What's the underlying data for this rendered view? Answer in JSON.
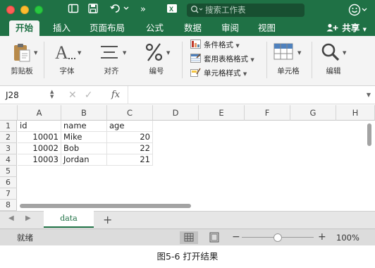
{
  "titlebar": {
    "search_placeholder": "搜索工作表",
    "colors": {
      "brand": "#1f7145"
    }
  },
  "tabs": [
    {
      "label": "开始",
      "active": true
    },
    {
      "label": "插入"
    },
    {
      "label": "页面布局"
    },
    {
      "label": "公式"
    },
    {
      "label": "数据"
    },
    {
      "label": "审阅"
    },
    {
      "label": "视图"
    }
  ],
  "share_label": "共享",
  "ribbon": {
    "clipboard": "剪贴板",
    "font": "字体",
    "align": "对齐",
    "number": "编号",
    "cf_conditional": "条件格式",
    "cf_table": "套用表格格式",
    "cf_cellstyle": "单元格样式",
    "cells": "单元格",
    "edit": "编辑"
  },
  "formula_bar": {
    "name_box": "J28",
    "fx": "fx",
    "value": ""
  },
  "grid": {
    "columns": [
      "A",
      "B",
      "C",
      "D",
      "E",
      "F",
      "G",
      "H"
    ],
    "rows": [
      "1",
      "2",
      "3",
      "4",
      "5",
      "6",
      "7",
      "8"
    ],
    "cells": [
      {
        "a": "id",
        "b": "name",
        "c": "age"
      },
      {
        "a": "10001",
        "b": "Mike",
        "c": "20"
      },
      {
        "a": "10002",
        "b": "Bob",
        "c": "22"
      },
      {
        "a": "10003",
        "b": "Jordan",
        "c": "21"
      }
    ]
  },
  "sheet_tabs": [
    {
      "name": "data",
      "active": true
    }
  ],
  "status": {
    "ready": "就绪",
    "zoom": "100%",
    "zoom_minus": "−",
    "zoom_plus": "+"
  },
  "caption": "图5-6  打开结果"
}
